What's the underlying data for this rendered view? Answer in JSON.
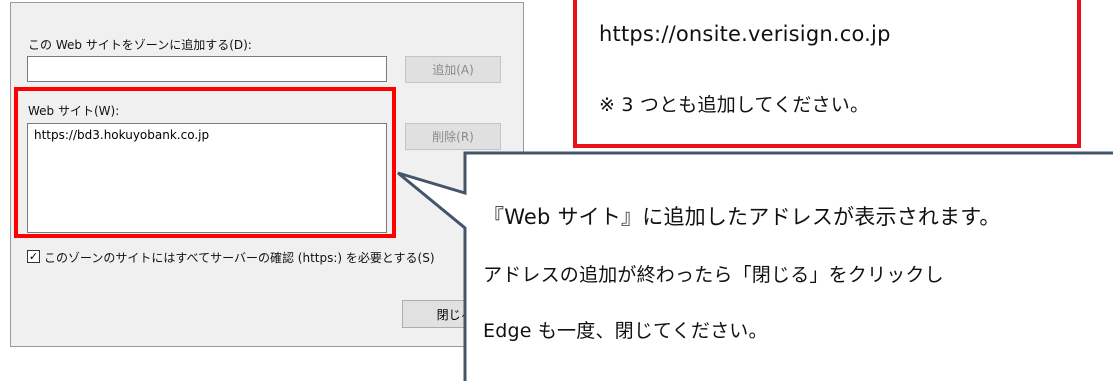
{
  "dialog": {
    "add_label": "この Web サイトをゾーンに追加する(D):",
    "add_input_value": "",
    "add_button": "追加(A)",
    "websites_label": "Web サイト(W):",
    "websites": [
      "https://bd3.hokuyobank.co.jp"
    ],
    "remove_button": "削除(R)",
    "require_https_checked": true,
    "require_https_label": "このゾーンのサイトにはすべてサーバーの確認 (https:) を必要とする(S)",
    "close_button": "閉じる("
  },
  "callout_top": {
    "url": "https://onsite.verisign.co.jp",
    "note": "※ 3 つとも追加してください。"
  },
  "callout_bottom": {
    "line1": "『Web サイト』に追加したアドレスが表示されます。",
    "line2": "アドレスの追加が終わったら「閉じる」をクリックし",
    "line3": "Edge も一度、閉じてください。"
  },
  "colors": {
    "highlight_red": "#ff0000",
    "callout_border_blue": "#44546a",
    "dialog_bg": "#f0f0f0"
  }
}
